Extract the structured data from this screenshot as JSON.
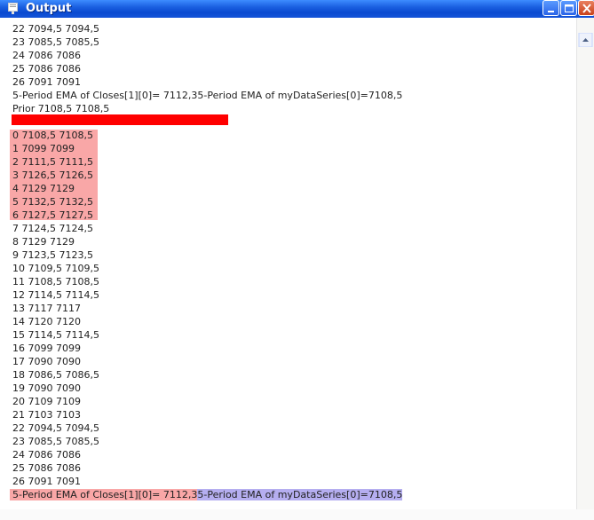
{
  "window": {
    "title": "Output"
  },
  "lines_top": [
    "22 7094,5 7094,5",
    "23 7085,5 7085,5",
    "24 7086 7086",
    "25 7086 7086",
    "26 7091 7091",
    "5-Period EMA of Closes[1][0]= 7112,35-Period EMA of myDataSeries[0]=7108,5",
    "Prior 7108,5 7108,5"
  ],
  "lines_highlight": [
    "0 7108,5 7108,5",
    "1 7099 7099",
    "2 7111,5 7111,5",
    "3 7126,5 7126,5",
    "4 7129 7129",
    "5 7132,5 7132,5",
    "6 7127,5 7127,5"
  ],
  "lines_rest": [
    "7 7124,5 7124,5",
    "8 7129 7129",
    "9 7123,5 7123,5",
    "10 7109,5 7109,5",
    "11 7108,5 7108,5",
    "12 7114,5 7114,5",
    "13 7117 7117",
    "14 7120 7120",
    "15 7114,5 7114,5",
    "16 7099 7099",
    "17 7090 7090",
    "18 7086,5 7086,5",
    "19 7090 7090",
    "20 7109 7109",
    "21 7103 7103",
    "22 7094,5 7094,5",
    "23 7085,5 7085,5",
    "24 7086 7086",
    "25 7086 7086",
    "26 7091 7091"
  ],
  "last_line": {
    "part1": "5-Period EMA of Closes[1][0]= 7112,3",
    "part2": "5-Period EMA of myDataSeries[0]=7108,5"
  },
  "colors": {
    "highlight_red": "#f9a7a7",
    "highlight_purple": "#b5aef0",
    "red_bar": "#ff0000",
    "titlebar": "#1a5fe0"
  },
  "icons": {
    "title": "output-window-icon",
    "minimize": "minimize-icon",
    "maximize": "maximize-icon",
    "close": "close-icon"
  }
}
